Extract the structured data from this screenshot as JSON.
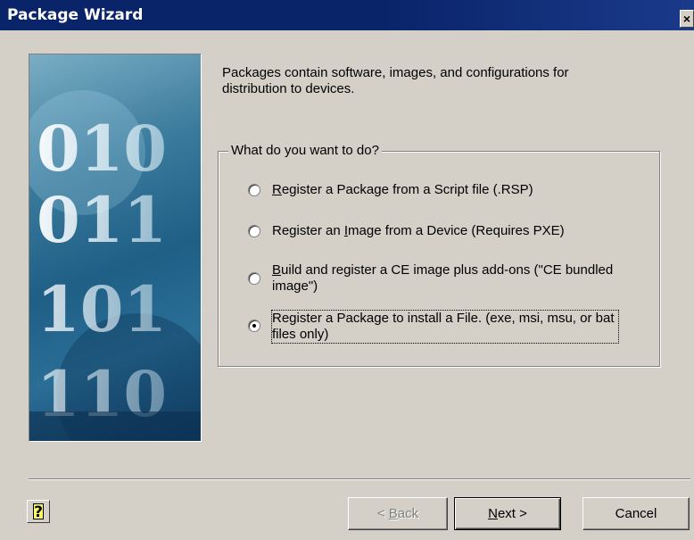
{
  "window": {
    "title": "Package Wizard",
    "close_glyph": "×"
  },
  "banner": {
    "rows": [
      "010",
      "011",
      "101",
      "110"
    ],
    "icon": "binary-digits-banner"
  },
  "intro": {
    "text": "Packages contain software, images, and configurations for distribution to devices."
  },
  "group": {
    "legend": "What do you want to do?",
    "options": [
      {
        "pre": "",
        "key": "R",
        "post": "egister a Package from a Script file (.RSP)",
        "checked": false
      },
      {
        "pre": "Register an ",
        "key": "I",
        "post": "mage from a Device (Requires PXE)",
        "checked": false
      },
      {
        "pre": "",
        "key": "B",
        "post": "uild and register a CE image plus add-ons (\"CE bundled image\")",
        "checked": false
      },
      {
        "pre": "Register a Package to install a File. (exe, msi, msu, or bat files only)",
        "key": "",
        "post": "",
        "checked": true
      }
    ]
  },
  "buttons": {
    "help_glyph": "?",
    "back": {
      "pre": "< ",
      "key": "B",
      "post": "ack"
    },
    "next": {
      "pre": "",
      "key": "N",
      "post": "ext >"
    },
    "cancel": "Cancel"
  }
}
